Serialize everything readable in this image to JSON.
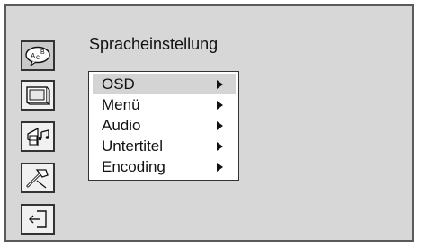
{
  "window": {
    "title": "Spracheinstellung"
  },
  "sidebar": {
    "items": [
      {
        "icon": "language-abc-icon",
        "active": true
      },
      {
        "icon": "tv-screen-icon",
        "active": false
      },
      {
        "icon": "speaker-music-icon",
        "active": false
      },
      {
        "icon": "tools-wrench-icon",
        "active": false
      },
      {
        "icon": "exit-icon",
        "active": false
      }
    ]
  },
  "menu": {
    "items": [
      {
        "label": "OSD",
        "selected": true
      },
      {
        "label": "Menü",
        "selected": false
      },
      {
        "label": "Audio",
        "selected": false
      },
      {
        "label": "Untertitel",
        "selected": false
      },
      {
        "label": "Encoding",
        "selected": false
      }
    ]
  }
}
